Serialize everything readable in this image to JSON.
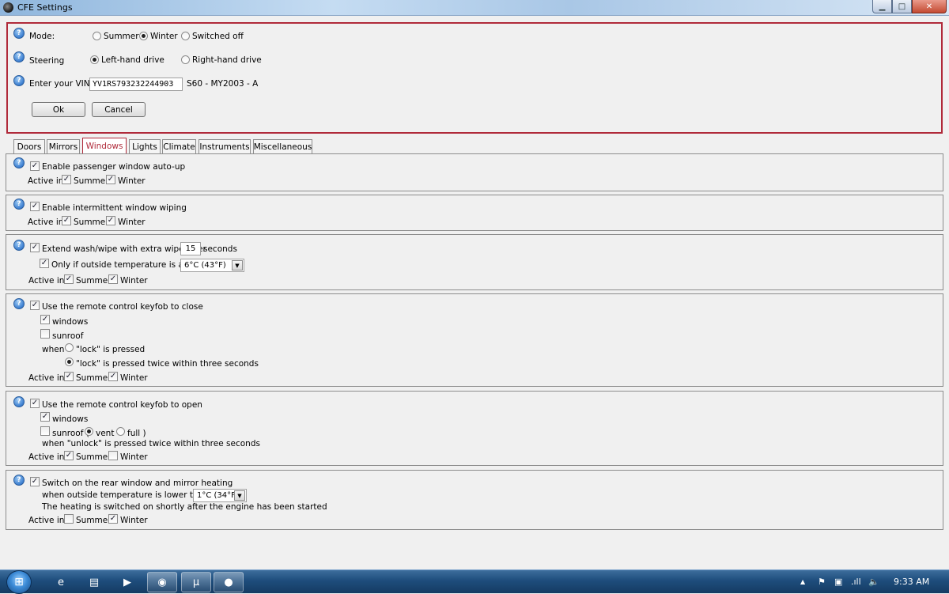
{
  "window": {
    "title": "CFE Settings",
    "controls": {
      "minimize": "▁",
      "maximize": "□",
      "close": "✕"
    }
  },
  "top": {
    "help_glyph": "?",
    "mode_label": "Mode:",
    "mode_options": [
      "Summer",
      "Winter",
      "Switched off"
    ],
    "mode_selected": "Winter",
    "steering_label": "Steering",
    "steering_options": [
      "Left-hand drive",
      "Right-hand drive"
    ],
    "steering_selected": "Left-hand drive",
    "vin_label": "Enter your VIN:",
    "vin_value": "YV1RS793232244903",
    "vin_decoded": "S60 - MY2003 - A",
    "ok_label": "Ok",
    "cancel_label": "Cancel"
  },
  "tabs": [
    "Doors",
    "Mirrors",
    "Windows",
    "Lights",
    "Climate",
    "Instruments",
    "Miscellaneous"
  ],
  "active_tab": "Windows",
  "common": {
    "active_in": "Active in",
    "summer": "Summer",
    "winter": "Winter",
    "check_glyph": "✓",
    "combo_arrow": "▼"
  },
  "sections": {
    "auto_up": {
      "label": "Enable passenger window auto-up",
      "enabled": true,
      "summer": true,
      "winter": true
    },
    "intermittent": {
      "label": "Enable intermittent window wiping",
      "enabled": true,
      "summer": true,
      "winter": true
    },
    "wash": {
      "label": "Extend wash/wipe with extra wipe after",
      "seconds_value": "15",
      "seconds_label": "seconds",
      "temp_label": "Only if outside temperature is above",
      "temp_value": "6°C (43°F)",
      "enabled": true,
      "temp_enabled": true,
      "summer": true,
      "winter": true
    },
    "keyfob_close": {
      "label": "Use the remote control keyfob to close",
      "windows": "windows",
      "sunroof": "sunroof",
      "when": "when",
      "opt1": "\"lock\" is pressed",
      "opt2": "\"lock\" is pressed twice within three seconds",
      "selected": "opt2",
      "enabled": true,
      "windows_checked": true,
      "sunroof_checked": false,
      "summer": true,
      "winter": true
    },
    "keyfob_open": {
      "label": "Use the remote control keyfob to open",
      "windows": "windows",
      "sunroof": "sunroof (",
      "vent": "vent",
      "full": "full )",
      "when_text": "when \"unlock\" is pressed twice within three seconds",
      "selected": "vent",
      "enabled": true,
      "windows_checked": true,
      "sunroof_checked": false,
      "summer": true,
      "winter": false
    },
    "heating": {
      "label": "Switch on the rear window and mirror heating",
      "temp_label": "when outside temperature is lower than",
      "temp_value": "1°C (34°F)",
      "note": "The heating is switched on shortly after the engine has been started",
      "enabled": true,
      "summer": false,
      "winter": true
    }
  },
  "taskbar": {
    "start_glyph": "⊞",
    "apps": [
      {
        "name": "internet-explorer",
        "glyph": "e"
      },
      {
        "name": "file-explorer",
        "glyph": "▤"
      },
      {
        "name": "media-player",
        "glyph": "▶"
      },
      {
        "name": "chrome",
        "glyph": "◉"
      },
      {
        "name": "torrent",
        "glyph": "μ"
      },
      {
        "name": "cfe-app",
        "glyph": "●"
      }
    ],
    "tray_glyphs": {
      "up": "▲",
      "flag": "⚑",
      "gift": "▣",
      "signal": ".ıll",
      "volume": "🔈"
    },
    "clock": "9:33 AM"
  }
}
